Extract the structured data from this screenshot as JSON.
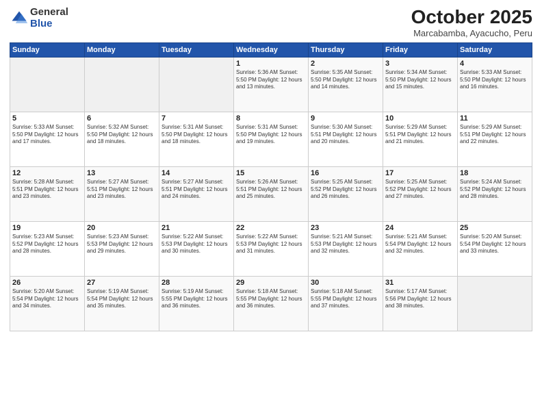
{
  "logo": {
    "general": "General",
    "blue": "Blue"
  },
  "title": "October 2025",
  "subtitle": "Marcabamba, Ayacucho, Peru",
  "weekdays": [
    "Sunday",
    "Monday",
    "Tuesday",
    "Wednesday",
    "Thursday",
    "Friday",
    "Saturday"
  ],
  "weeks": [
    [
      {
        "day": "",
        "info": ""
      },
      {
        "day": "",
        "info": ""
      },
      {
        "day": "",
        "info": ""
      },
      {
        "day": "1",
        "info": "Sunrise: 5:36 AM\nSunset: 5:50 PM\nDaylight: 12 hours\nand 13 minutes."
      },
      {
        "day": "2",
        "info": "Sunrise: 5:35 AM\nSunset: 5:50 PM\nDaylight: 12 hours\nand 14 minutes."
      },
      {
        "day": "3",
        "info": "Sunrise: 5:34 AM\nSunset: 5:50 PM\nDaylight: 12 hours\nand 15 minutes."
      },
      {
        "day": "4",
        "info": "Sunrise: 5:33 AM\nSunset: 5:50 PM\nDaylight: 12 hours\nand 16 minutes."
      }
    ],
    [
      {
        "day": "5",
        "info": "Sunrise: 5:33 AM\nSunset: 5:50 PM\nDaylight: 12 hours\nand 17 minutes."
      },
      {
        "day": "6",
        "info": "Sunrise: 5:32 AM\nSunset: 5:50 PM\nDaylight: 12 hours\nand 18 minutes."
      },
      {
        "day": "7",
        "info": "Sunrise: 5:31 AM\nSunset: 5:50 PM\nDaylight: 12 hours\nand 18 minutes."
      },
      {
        "day": "8",
        "info": "Sunrise: 5:31 AM\nSunset: 5:50 PM\nDaylight: 12 hours\nand 19 minutes."
      },
      {
        "day": "9",
        "info": "Sunrise: 5:30 AM\nSunset: 5:51 PM\nDaylight: 12 hours\nand 20 minutes."
      },
      {
        "day": "10",
        "info": "Sunrise: 5:29 AM\nSunset: 5:51 PM\nDaylight: 12 hours\nand 21 minutes."
      },
      {
        "day": "11",
        "info": "Sunrise: 5:29 AM\nSunset: 5:51 PM\nDaylight: 12 hours\nand 22 minutes."
      }
    ],
    [
      {
        "day": "12",
        "info": "Sunrise: 5:28 AM\nSunset: 5:51 PM\nDaylight: 12 hours\nand 23 minutes."
      },
      {
        "day": "13",
        "info": "Sunrise: 5:27 AM\nSunset: 5:51 PM\nDaylight: 12 hours\nand 23 minutes."
      },
      {
        "day": "14",
        "info": "Sunrise: 5:27 AM\nSunset: 5:51 PM\nDaylight: 12 hours\nand 24 minutes."
      },
      {
        "day": "15",
        "info": "Sunrise: 5:26 AM\nSunset: 5:51 PM\nDaylight: 12 hours\nand 25 minutes."
      },
      {
        "day": "16",
        "info": "Sunrise: 5:25 AM\nSunset: 5:52 PM\nDaylight: 12 hours\nand 26 minutes."
      },
      {
        "day": "17",
        "info": "Sunrise: 5:25 AM\nSunset: 5:52 PM\nDaylight: 12 hours\nand 27 minutes."
      },
      {
        "day": "18",
        "info": "Sunrise: 5:24 AM\nSunset: 5:52 PM\nDaylight: 12 hours\nand 28 minutes."
      }
    ],
    [
      {
        "day": "19",
        "info": "Sunrise: 5:23 AM\nSunset: 5:52 PM\nDaylight: 12 hours\nand 28 minutes."
      },
      {
        "day": "20",
        "info": "Sunrise: 5:23 AM\nSunset: 5:53 PM\nDaylight: 12 hours\nand 29 minutes."
      },
      {
        "day": "21",
        "info": "Sunrise: 5:22 AM\nSunset: 5:53 PM\nDaylight: 12 hours\nand 30 minutes."
      },
      {
        "day": "22",
        "info": "Sunrise: 5:22 AM\nSunset: 5:53 PM\nDaylight: 12 hours\nand 31 minutes."
      },
      {
        "day": "23",
        "info": "Sunrise: 5:21 AM\nSunset: 5:53 PM\nDaylight: 12 hours\nand 32 minutes."
      },
      {
        "day": "24",
        "info": "Sunrise: 5:21 AM\nSunset: 5:54 PM\nDaylight: 12 hours\nand 32 minutes."
      },
      {
        "day": "25",
        "info": "Sunrise: 5:20 AM\nSunset: 5:54 PM\nDaylight: 12 hours\nand 33 minutes."
      }
    ],
    [
      {
        "day": "26",
        "info": "Sunrise: 5:20 AM\nSunset: 5:54 PM\nDaylight: 12 hours\nand 34 minutes."
      },
      {
        "day": "27",
        "info": "Sunrise: 5:19 AM\nSunset: 5:54 PM\nDaylight: 12 hours\nand 35 minutes."
      },
      {
        "day": "28",
        "info": "Sunrise: 5:19 AM\nSunset: 5:55 PM\nDaylight: 12 hours\nand 36 minutes."
      },
      {
        "day": "29",
        "info": "Sunrise: 5:18 AM\nSunset: 5:55 PM\nDaylight: 12 hours\nand 36 minutes."
      },
      {
        "day": "30",
        "info": "Sunrise: 5:18 AM\nSunset: 5:55 PM\nDaylight: 12 hours\nand 37 minutes."
      },
      {
        "day": "31",
        "info": "Sunrise: 5:17 AM\nSunset: 5:56 PM\nDaylight: 12 hours\nand 38 minutes."
      },
      {
        "day": "",
        "info": ""
      }
    ]
  ]
}
